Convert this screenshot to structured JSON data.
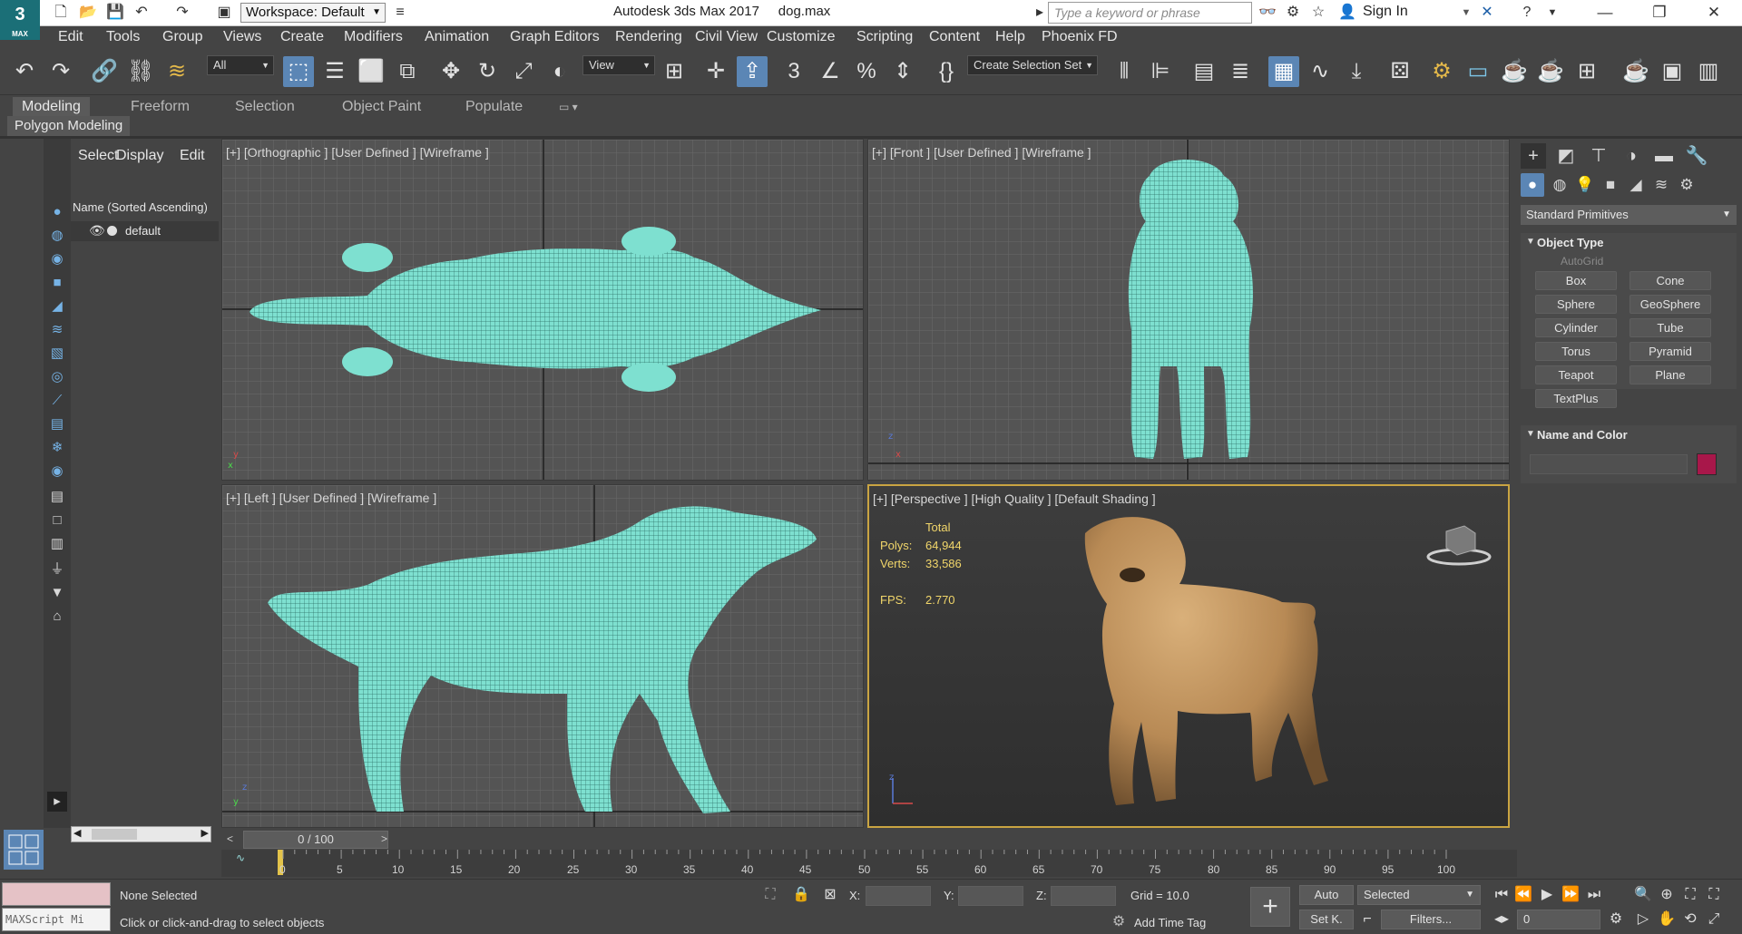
{
  "titlebar": {
    "app_logo": "3",
    "app_logo_sub": "MAX",
    "workspace": "Workspace: Default",
    "title": "Autodesk 3ds Max 2017     dog.max",
    "search_placeholder": "Type a keyword or phrase",
    "sign_in": "Sign In"
  },
  "menu": [
    "Edit",
    "Tools",
    "Group",
    "Views",
    "Create",
    "Modifiers",
    "Animation",
    "Graph Editors",
    "Rendering",
    "Civil View",
    "Customize",
    "Scripting",
    "Content",
    "Help",
    "Phoenix FD"
  ],
  "toolbar": {
    "selection_filter": "All",
    "ref_coord": "View",
    "selection_set": "Create Selection Set"
  },
  "ribbon": {
    "tabs": [
      "Modeling",
      "Freeform",
      "Selection",
      "Object Paint",
      "Populate"
    ],
    "active_tab": "Modeling",
    "panel_label": "Polygon Modeling"
  },
  "scene_explorer": {
    "tabs": [
      "Select",
      "Display",
      "Edit"
    ],
    "column_header": "Name (Sorted Ascending)",
    "items": [
      "default"
    ]
  },
  "viewports": {
    "top": "[+] [Orthographic ] [User Defined ] [Wireframe ]",
    "front": "[+] [Front ] [User Defined ] [Wireframe ]",
    "left": "[+] [Left ] [User Defined ] [Wireframe ]",
    "perspective": "[+] [Perspective ] [High Quality ] [Default Shading ]"
  },
  "stats": {
    "total_label": "Total",
    "polys_label": "Polys:",
    "polys_value": "64,944",
    "verts_label": "Verts:",
    "verts_value": "33,586",
    "fps_label": "FPS:",
    "fps_value": "2.770"
  },
  "command_panel": {
    "category": "Standard Primitives",
    "object_type_title": "Object Type",
    "autogrid": "AutoGrid",
    "primitives": [
      "Box",
      "Cone",
      "Sphere",
      "GeoSphere",
      "Cylinder",
      "Tube",
      "Torus",
      "Pyramid",
      "Teapot",
      "Plane",
      "TextPlus"
    ],
    "name_color_title": "Name and Color",
    "object_color": "#a8174a"
  },
  "timeline": {
    "slider": "0 / 100",
    "ticks": [
      "0",
      "5",
      "10",
      "15",
      "20",
      "25",
      "30",
      "35",
      "40",
      "45",
      "50",
      "55",
      "60",
      "65",
      "70",
      "75",
      "80",
      "85",
      "90",
      "95",
      "100"
    ]
  },
  "status": {
    "maxscript_hint": "MAXScript Mi",
    "selection": "None Selected",
    "prompt": "Click or click-and-drag to select objects",
    "x_label": "X:",
    "y_label": "Y:",
    "z_label": "Z:",
    "grid": "Grid = 10.0",
    "add_time_tag": "Add Time Tag",
    "auto_key": "Auto",
    "set_key": "Set K.",
    "key_filter": "Selected",
    "filters": "Filters...",
    "frame": "0"
  },
  "colors": {
    "wireframe": "#7ee0d0",
    "accent_blue": "#5b86b5",
    "stats_yellow": "#f1d66a",
    "active_viewport_border": "#c9a442"
  }
}
